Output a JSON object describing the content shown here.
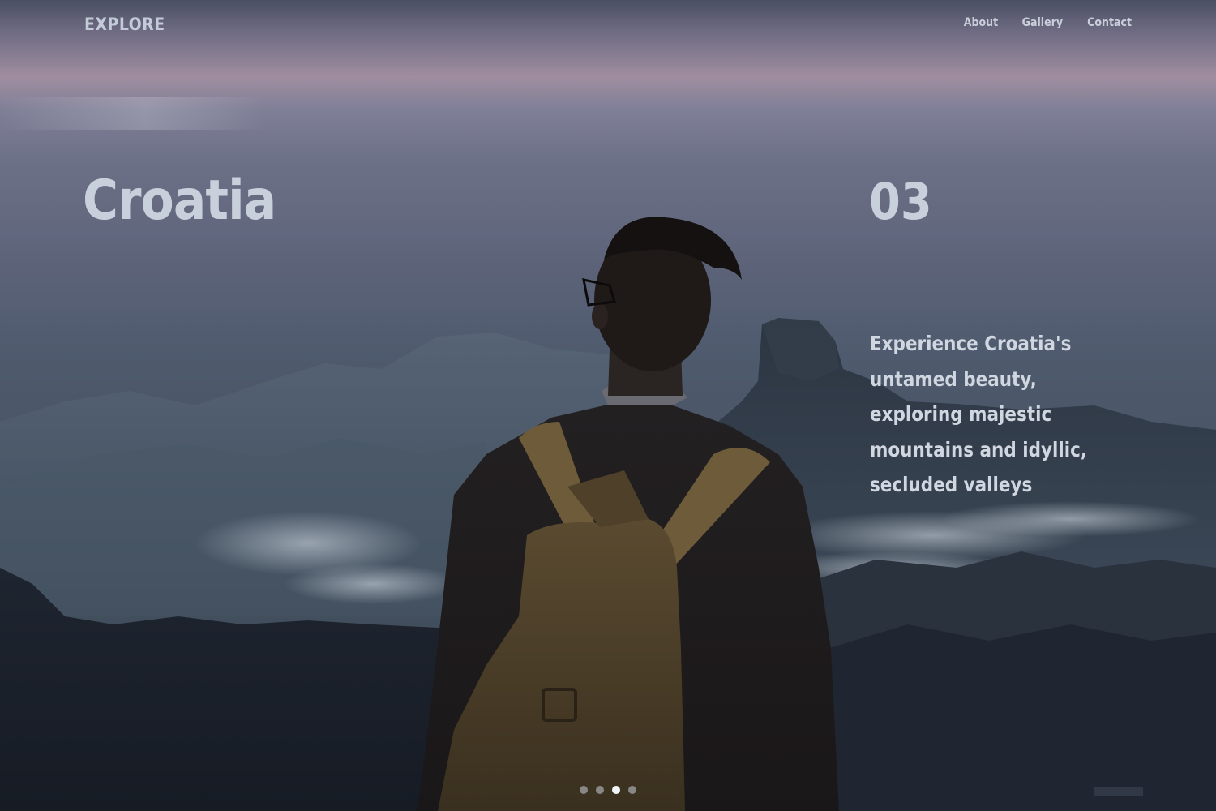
{
  "nav": {
    "brand": "EXPLORE",
    "links": [
      "About",
      "Gallery",
      "Contact"
    ]
  },
  "hero": {
    "title": "Croatia",
    "index": "03",
    "description": "Experience Croatia's untamed beauty, exploring majestic mountains and idyllic, secluded valleys",
    "background_image": "hiker with backpack overlooking misty mountains at dusk"
  },
  "slider": {
    "total": 4,
    "active": 3
  },
  "colors": {
    "text": "#c8d0dc",
    "dot_active": "#f2f4f7",
    "dot_inactive": "#9aa2b0"
  }
}
